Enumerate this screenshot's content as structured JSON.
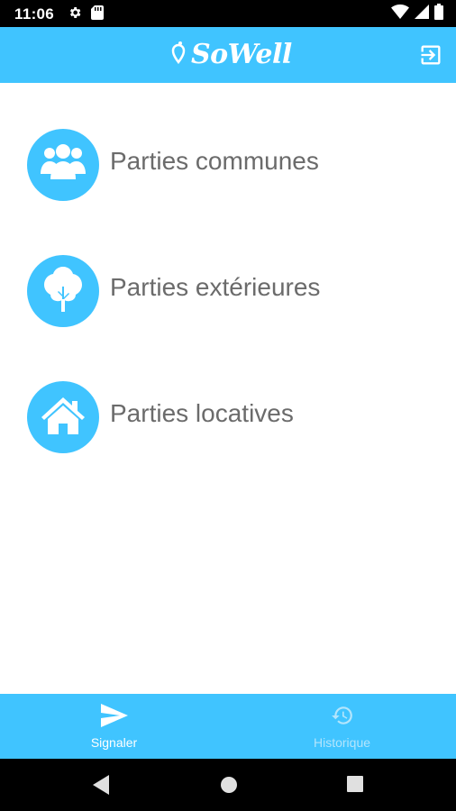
{
  "status_bar": {
    "time": "11:06",
    "icons": [
      "gear-icon",
      "sd-card-icon",
      "wifi-icon",
      "signal-icon",
      "battery-icon"
    ]
  },
  "app_bar": {
    "logo_text": "SoWell",
    "logout_icon": "logout-icon"
  },
  "menu": {
    "items": [
      {
        "label": "Parties communes",
        "icon": "group-icon"
      },
      {
        "label": "Parties extérieures",
        "icon": "tree-icon"
      },
      {
        "label": "Parties locatives",
        "icon": "house-icon"
      }
    ]
  },
  "bottom_nav": {
    "tabs": [
      {
        "label": "Signaler",
        "icon": "send-icon",
        "active": true
      },
      {
        "label": "Historique",
        "icon": "history-icon",
        "active": false
      }
    ]
  },
  "colors": {
    "primary": "#40c4ff",
    "text": "#6b6b6b",
    "inactive": "#b3e5fc"
  }
}
